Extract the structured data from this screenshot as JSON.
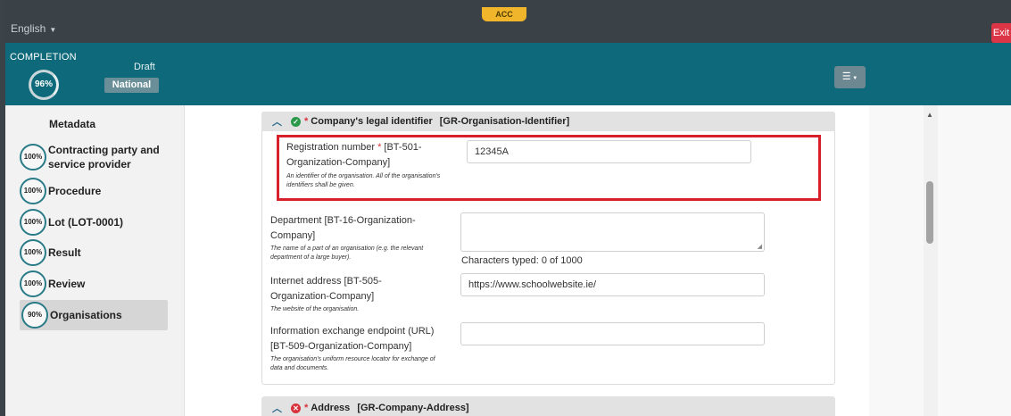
{
  "topbar": {
    "language": "English",
    "env_badge": "ACC",
    "exit_label": "Exit"
  },
  "completion": {
    "label": "COMPLETION",
    "percent": "96%",
    "status": "Draft",
    "scope": "National"
  },
  "sidebar": {
    "metadata_label": "Metadata",
    "items": [
      {
        "percent": "100%",
        "label": "Contracting party and service provider",
        "active": false
      },
      {
        "percent": "100%",
        "label": "Procedure",
        "active": false
      },
      {
        "percent": "100%",
        "label": "Lot (LOT-0001)",
        "active": false
      },
      {
        "percent": "100%",
        "label": "Result",
        "active": false
      },
      {
        "percent": "100%",
        "label": "Review",
        "active": false
      },
      {
        "percent": "90%",
        "label": "Organisations",
        "active": true
      }
    ]
  },
  "section_identifier": {
    "title": "Company's legal identifier",
    "code": "[GR-Organisation-Identifier]",
    "status_icon": "check-circle-icon"
  },
  "fields": {
    "registration": {
      "label_line1": "Registration number",
      "label_line2": "[BT-501-",
      "label_line3": "Organization-Company]",
      "help": "An identifier of the organisation. All of the organisation's identifiers shall be given.",
      "value": "12345A"
    },
    "department": {
      "label_line1": "Department [BT-16-Organization-",
      "label_line2": "Company]",
      "help": "The name of a part of an organisation (e.g. the relevant department of a large buyer).",
      "value": "",
      "char_count": "Characters typed: 0 of 1000"
    },
    "internet": {
      "label_line1": "Internet address [BT-505-",
      "label_line2": "Organization-Company]",
      "help": "The website of the organisation.",
      "value": "https://www.schoolwebsite.ie/"
    },
    "endpoint": {
      "label_line1": "Information exchange endpoint (URL)",
      "label_line2": "[BT-509-Organization-Company]",
      "help": "The organisation's uniform resource locator for exchange of data and documents.",
      "value": ""
    }
  },
  "section_address": {
    "title": "Address",
    "code": "[GR-Company-Address]",
    "status_icon": "error-circle-icon"
  }
}
